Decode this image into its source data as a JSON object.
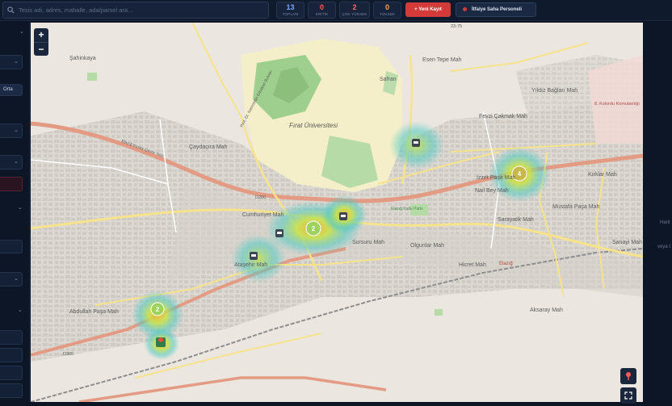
{
  "search": {
    "placeholder": "Tesis adı, adres, mahalle, ada/parsel ara..."
  },
  "stats": [
    {
      "value": "13",
      "label": "TOPLAM",
      "color": "#7aa7ff"
    },
    {
      "value": "0",
      "label": "KRİTİK",
      "color": "#ff5a5a"
    },
    {
      "value": "2",
      "label": "ÇOK YÜKSEK",
      "color": "#ff6b6b"
    },
    {
      "value": "0",
      "label": "YÜKSEK",
      "color": "#f5a35a"
    }
  ],
  "actions": {
    "new_record_label": "+ Yeni Kayıt",
    "personnel_label": "İtfaiye Saha Personeli"
  },
  "sidebar": {
    "chip_label": "Orta"
  },
  "map": {
    "zoom_in": "+",
    "zoom_out": "−",
    "labels": [
      "Şahinkaya",
      "Esen Tepe Mah",
      "Safran",
      "Prof. Dr. Necmettin Erbakan Bulvarı",
      "Fırat Üniversitesi",
      "Yıldız Bağları Mah",
      "Fevzi Çakmak Mah",
      "Çaydaçıra Mah",
      "Elazığ Kutlu Parkı",
      "Cumhuriyet Mah",
      "Sursuru Mah",
      "Olgunlar Mah",
      "Hicret Mah",
      "Sarayatik Mah",
      "Mustafa Paşa Mah",
      "Nail Bey Mah",
      "İzzet Paşa Mah",
      "Kırklar Mah",
      "Sanayi Mah",
      "Ataşehir Mah",
      "Abdullah Paşa Mah",
      "Aksaray Mah",
      "Elazığ",
      "8. Kolordu Komutanlığı",
      "Elazığ Kuzey Çevre Yolu",
      "D300",
      "D260",
      "23-75"
    ],
    "clusters": [
      "2",
      "2",
      "4"
    ],
    "heat_colors": {
      "low": "#4ec9c2",
      "mid": "#c6e24a",
      "high": "#f2b233"
    }
  },
  "right_panel": {
    "text1": "Harit",
    "text2": "veya t"
  }
}
